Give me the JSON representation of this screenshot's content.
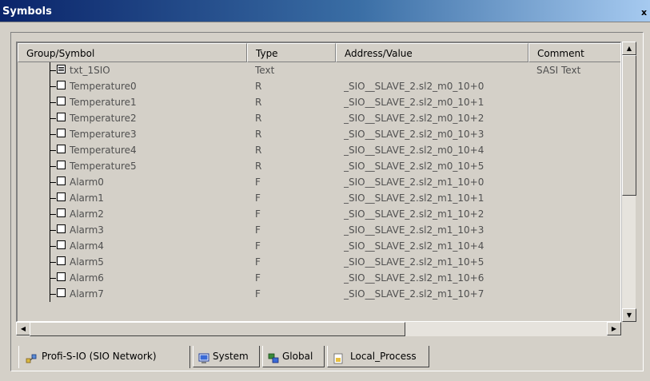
{
  "window": {
    "title": "Symbols",
    "close_glyph": "x"
  },
  "columns": [
    "Group/Symbol",
    "Type",
    "Address/Value",
    "Comment"
  ],
  "rows": [
    {
      "symbol": "txt_1SIO",
      "type": "Text",
      "address": "",
      "comment": "SASI Text",
      "icon": "text-signal-icon"
    },
    {
      "symbol": "Temperature0",
      "type": "R",
      "address": "_SIO__SLAVE_2.sl2_m0_10+0",
      "comment": "",
      "icon": "signal-icon"
    },
    {
      "symbol": "Temperature1",
      "type": "R",
      "address": "_SIO__SLAVE_2.sl2_m0_10+1",
      "comment": "",
      "icon": "signal-icon"
    },
    {
      "symbol": "Temperature2",
      "type": "R",
      "address": "_SIO__SLAVE_2.sl2_m0_10+2",
      "comment": "",
      "icon": "signal-icon"
    },
    {
      "symbol": "Temperature3",
      "type": "R",
      "address": "_SIO__SLAVE_2.sl2_m0_10+3",
      "comment": "",
      "icon": "signal-icon"
    },
    {
      "symbol": "Temperature4",
      "type": "R",
      "address": "_SIO__SLAVE_2.sl2_m0_10+4",
      "comment": "",
      "icon": "signal-icon"
    },
    {
      "symbol": "Temperature5",
      "type": "R",
      "address": "_SIO__SLAVE_2.sl2_m0_10+5",
      "comment": "",
      "icon": "signal-icon"
    },
    {
      "symbol": "Alarm0",
      "type": "F",
      "address": "_SIO__SLAVE_2.sl2_m1_10+0",
      "comment": "",
      "icon": "signal-icon"
    },
    {
      "symbol": "Alarm1",
      "type": "F",
      "address": "_SIO__SLAVE_2.sl2_m1_10+1",
      "comment": "",
      "icon": "signal-icon"
    },
    {
      "symbol": "Alarm2",
      "type": "F",
      "address": "_SIO__SLAVE_2.sl2_m1_10+2",
      "comment": "",
      "icon": "signal-icon"
    },
    {
      "symbol": "Alarm3",
      "type": "F",
      "address": "_SIO__SLAVE_2.sl2_m1_10+3",
      "comment": "",
      "icon": "signal-icon"
    },
    {
      "symbol": "Alarm4",
      "type": "F",
      "address": "_SIO__SLAVE_2.sl2_m1_10+4",
      "comment": "",
      "icon": "signal-icon"
    },
    {
      "symbol": "Alarm5",
      "type": "F",
      "address": "_SIO__SLAVE_2.sl2_m1_10+5",
      "comment": "",
      "icon": "signal-icon"
    },
    {
      "symbol": "Alarm6",
      "type": "F",
      "address": "_SIO__SLAVE_2.sl2_m1_10+6",
      "comment": "",
      "icon": "signal-icon"
    },
    {
      "symbol": "Alarm7",
      "type": "F",
      "address": "_SIO__SLAVE_2.sl2_m1_10+7",
      "comment": "",
      "icon": "signal-icon"
    }
  ],
  "scrollbars": {
    "up": "▲",
    "down": "▼",
    "left": "◀",
    "right": "▶"
  },
  "tabs": [
    {
      "label": "Profi-S-IO (SIO Network)",
      "icon": "network-icon",
      "active": true
    },
    {
      "label": "System",
      "icon": "system-icon",
      "active": false
    },
    {
      "label": "Global",
      "icon": "global-icon",
      "active": false
    },
    {
      "label": "Local_Process",
      "icon": "local-process-icon",
      "active": false
    }
  ],
  "colors": {
    "face": "#d4d0c8",
    "title_start": "#0a246a",
    "title_end": "#a6caf0",
    "cell_text": "#505050"
  }
}
